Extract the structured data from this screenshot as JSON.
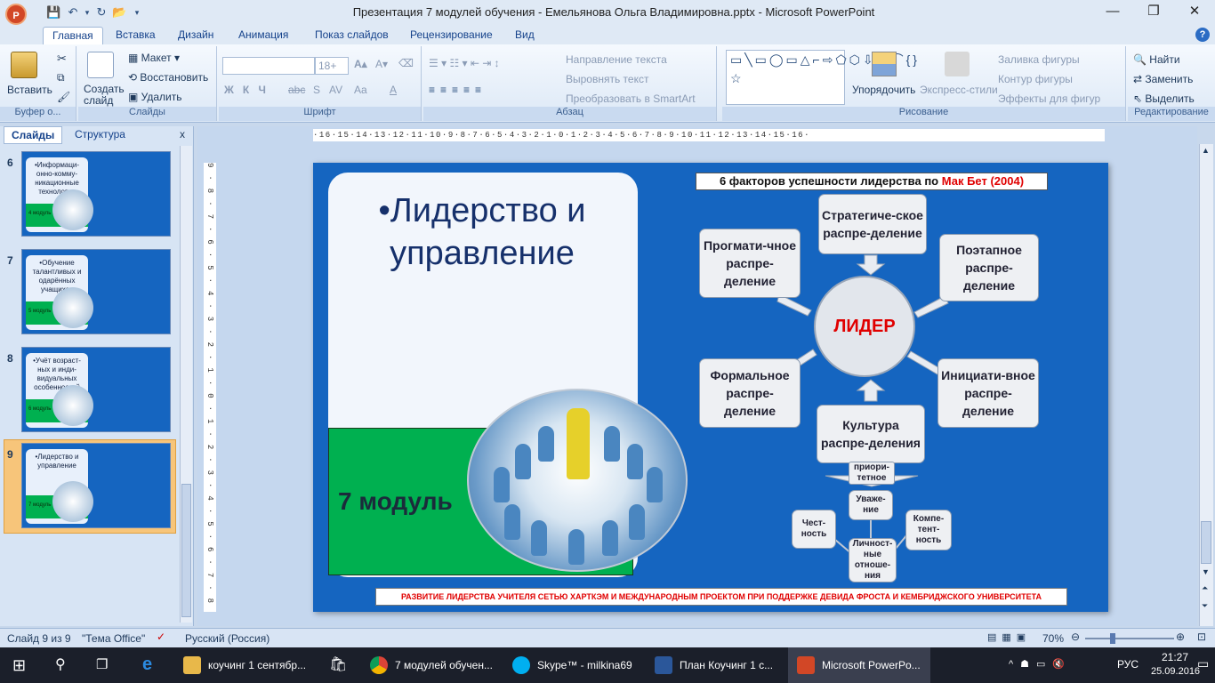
{
  "window": {
    "title": "Презентация 7 модулей обучения - Емельянова Ольга Владимировна.pptx - Microsoft PowerPoint",
    "minimize": "—",
    "maximize": "❐",
    "close": "✕"
  },
  "ribbon_tabs": [
    "Главная",
    "Вставка",
    "Дизайн",
    "Анимация",
    "Показ слайдов",
    "Рецензирование",
    "Вид"
  ],
  "ribbon": {
    "clipboard": {
      "label": "Буфер о...",
      "paste": "Вставить"
    },
    "slides": {
      "label": "Слайды",
      "new_slide": "Создать слайд",
      "layout": "Макет",
      "reset": "Восстановить",
      "delete": "Удалить"
    },
    "font": {
      "label": "Шрифт",
      "size": "18+"
    },
    "paragraph": {
      "label": "Абзац",
      "text_direction": "Направление текста",
      "align_text": "Выровнять текст",
      "smartart": "Преобразовать в SmartArt"
    },
    "drawing": {
      "label": "Рисование",
      "arrange": "Упорядочить",
      "quick_styles": "Экспресс-стили",
      "fill": "Заливка фигуры",
      "outline": "Контур фигуры",
      "effects": "Эффекты для фигур"
    },
    "editing": {
      "label": "Редактирование",
      "find": "Найти",
      "replace": "Заменить",
      "select": "Выделить"
    }
  },
  "panel": {
    "tab_slides": "Слайды",
    "tab_outline": "Структура",
    "thumbnails": [
      {
        "num": "6",
        "title": "•Информаци-онно-комму-никационные технологии",
        "module": "4 модуль"
      },
      {
        "num": "7",
        "title": "•Обучение талантливых и одарённых учащихся",
        "module": "5 модуль"
      },
      {
        "num": "8",
        "title": "•Учёт возраст-ных и инди-видуальных особенностей",
        "module": "6 модуль"
      },
      {
        "num": "9",
        "title": "•Лидерство и управление",
        "module": "7 модуль"
      }
    ]
  },
  "ruler": {
    "h": "·16·15·14·13·12·11·10·9·8·7·6·5·4·3·2·1·0·1·2·3·4·5·6·7·8·9·10·11·12·13·14·15·16·",
    "v": "9·8·7·6·5·4·3·2·1·0·1·2·3·4·5·6·7·8·9"
  },
  "slide": {
    "title": "•Лидерство и управление",
    "module": "7 модуль",
    "factors_title_prefix": "6 факторов успешности лидерства по ",
    "factors_title_author": "Мак Бет (2004)",
    "leader": "ЛИДЕР",
    "factors": {
      "strategic": "Стратегиче-ское распре-деление",
      "pragmatic": "Прогмати-чное распре-деление",
      "stepwise": "Поэтапное распре-деление",
      "formal": "Формальное распре-деление",
      "initiative": "Инициати-вное распре-деление",
      "culture": "Культура распре-деления"
    },
    "culture_sub": {
      "priority": "приори-тетное",
      "respect": "Уваже-ние",
      "honesty": "Чест-ность",
      "competence": "Компе-тент-ность",
      "personal": "Личност-ные отноше-ния"
    },
    "footer": "РАЗВИТИЕ ЛИДЕРСТВА УЧИТЕЛЯ СЕТЬЮ ХАРТКЭМ И МЕЖДУНАРОДНЫМ ПРОЕКТОМ ПРИ ПОДДЕРЖКЕ ДЕВИДА ФРОСТА И КЕМБРИДЖСКОГО УНИВЕРСИТЕТА"
  },
  "status": {
    "slide_of": "Слайд 9 из 9",
    "theme": "\"Тема Office\"",
    "language": "Русский (Россия)",
    "zoom": "70%"
  },
  "taskbar": {
    "items": [
      "коучинг 1 сентябр...",
      "7 модулей обучен...",
      "Skype™ - milkina69",
      "План Коучинг  1 с...",
      "Microsoft PowerPo..."
    ],
    "lang": "РУС",
    "time": "21:27",
    "date": "25.09.2016"
  }
}
